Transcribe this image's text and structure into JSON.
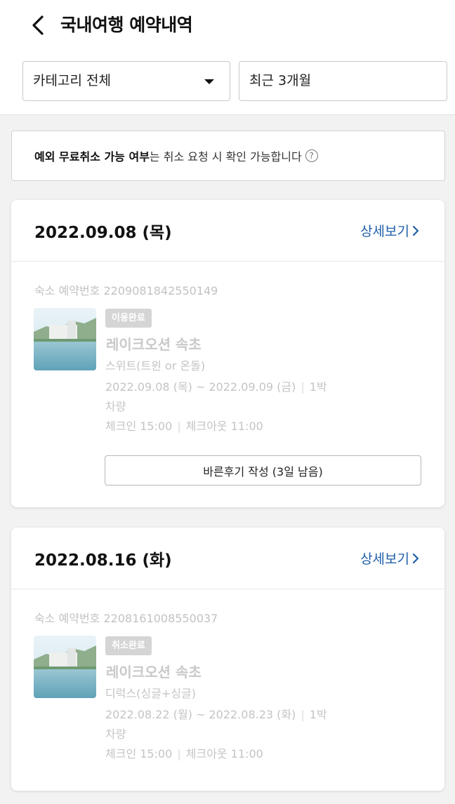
{
  "header": {
    "title": "국내여행 예약내역",
    "category_select": "카테고리 전체",
    "period_select": "최근 3개월"
  },
  "notice": {
    "bold": "예외 무료취소 가능 여부",
    "text": "는 취소 요청 시 확인 가능합니다",
    "help": "?"
  },
  "reservations": [
    {
      "date": "2022.09.08 (목)",
      "detail": "상세보기",
      "res_no": "숙소 예약번호 2209081842550149",
      "badge": "이용완료",
      "hotel": "레이크오션 속초",
      "room": "스위트(트윈 or 온돌)",
      "stay_dates": "2022.09.08 (목) ~ 2022.09.09 (금)",
      "nights": "1박",
      "car": "차량",
      "checkin": "체크인 15:00",
      "checkout": "체크아웃 11:00",
      "review_button": "바른후기 작성 (3일 남음)"
    },
    {
      "date": "2022.08.16 (화)",
      "detail": "상세보기",
      "res_no": "숙소 예약번호 2208161008550037",
      "badge": "취소완료",
      "hotel": "레이크오션 속초",
      "room": "디럭스(싱글+싱글)",
      "stay_dates": "2022.08.22 (월) ~ 2022.08.23 (화)",
      "nights": "1박",
      "car": "차량",
      "checkin": "체크인 15:00",
      "checkout": "체크아웃 11:00"
    }
  ],
  "colors": {
    "link": "#1f5fa8",
    "badge_bg": "#d5d5d5",
    "muted_text": "#c4c4c4"
  }
}
